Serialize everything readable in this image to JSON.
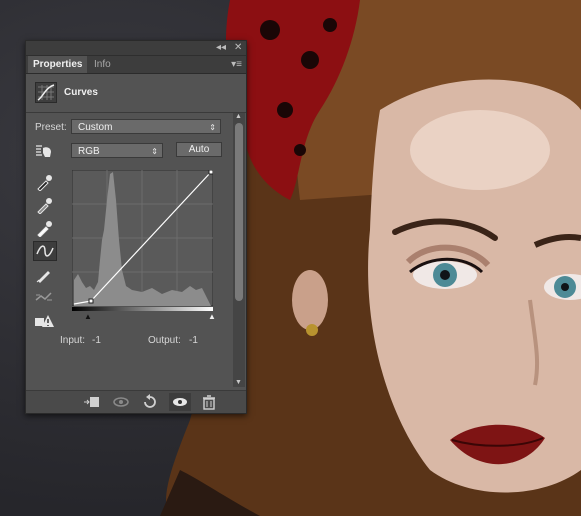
{
  "panel": {
    "tabs": [
      {
        "label": "Properties",
        "active": true
      },
      {
        "label": "Info",
        "active": false
      }
    ],
    "title": "Curves",
    "preset_label": "Preset:",
    "preset_value": "Custom",
    "channel_value": "RGB",
    "auto_label": "Auto",
    "input_label": "Input:",
    "input_value": "-1",
    "output_label": "Output:",
    "output_value": "-1",
    "collapse_glyph": "◂◂",
    "close_glyph": "✕"
  },
  "icons": {
    "tools": [
      "on-image-adjust-icon",
      "black-point-eyedropper-icon",
      "gray-point-eyedropper-icon",
      "white-point-eyedropper-icon",
      "curve-point-tool-icon",
      "pencil-icon",
      "smooth-icon",
      "clipping-warning-icon"
    ],
    "footer": [
      "clip-to-layer-icon",
      "view-previous-icon",
      "reset-icon",
      "visibility-icon",
      "trash-icon"
    ]
  },
  "colors": {
    "panel_bg": "#535353",
    "graph_bg": "#5a5a5a",
    "histogram": "#8c8c8c",
    "curve": "#ffffff"
  }
}
